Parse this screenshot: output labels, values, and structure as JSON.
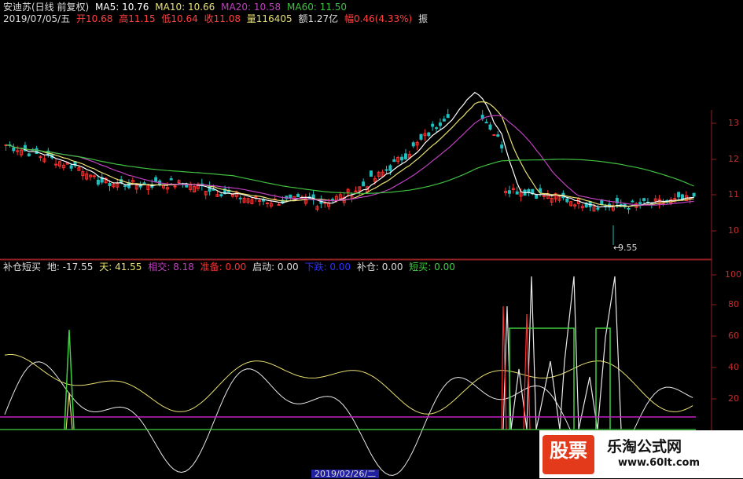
{
  "header": {
    "stock": "安迪苏(日线 前复权)",
    "ma5": "MA5: 10.76",
    "ma10": "MA10: 10.66",
    "ma20": "MA20: 10.58",
    "ma60": "MA60: 11.50",
    "date": "2019/07/05/五",
    "open": "开10.68",
    "high": "高11.15",
    "low": "低10.64",
    "close": "收11.08",
    "volume": "量116405",
    "amount": "额1.27亿",
    "change": "幅0.46(4.33%)",
    "amplitude": "振"
  },
  "price_axis": [
    "13",
    "12",
    "11",
    "10"
  ],
  "low_marker": "9.55",
  "indicator": {
    "name": "补仓短买",
    "di": "地: -17.55",
    "tian": "天: 41.55",
    "xiangjiao": "相交: 8.18",
    "zhunbei": "准备: 0.00",
    "qidong": "启动: 0.00",
    "xiadie": "下跌: 0.00",
    "bucang": "补仓: 0.00",
    "duanmai": "短买: 0.00"
  },
  "indicator_axis": [
    "100",
    "80",
    "60",
    "40",
    "20"
  ],
  "bottom_date": "2019/02/26/二",
  "watermark": {
    "logo": "股票",
    "site": "乐淘公式网",
    "url": "www.60lt.com"
  },
  "colors": {
    "ma5": "#ffffff",
    "ma10": "#e8e070",
    "ma20": "#c040c0",
    "ma60": "#40c040",
    "up": "#ff3030",
    "down": "#20c0c0"
  }
}
